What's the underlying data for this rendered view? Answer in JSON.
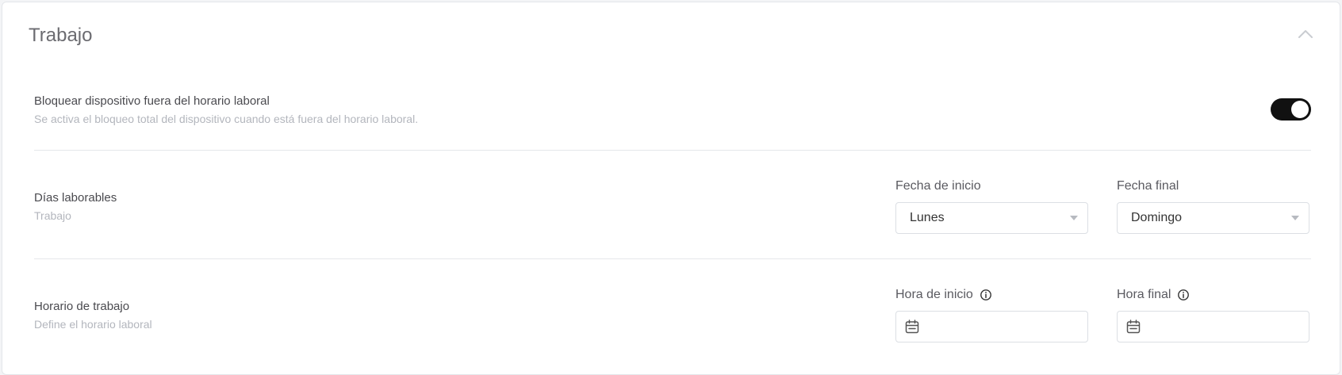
{
  "card": {
    "title": "Trabajo"
  },
  "lock_device": {
    "title": "Bloquear dispositivo fuera del horario laboral",
    "description": "Se activa el bloqueo total del dispositivo cuando está fuera del horario laboral.",
    "enabled": true
  },
  "workdays": {
    "title": "Días laborables",
    "description": "Trabajo",
    "start_label": "Fecha de inicio",
    "start_value": "Lunes",
    "end_label": "Fecha final",
    "end_value": "Domingo"
  },
  "schedule": {
    "title": "Horario de trabajo",
    "description": "Define el horario laboral",
    "start_label": "Hora de inicio",
    "start_value": "",
    "end_label": "Hora final",
    "end_value": ""
  }
}
